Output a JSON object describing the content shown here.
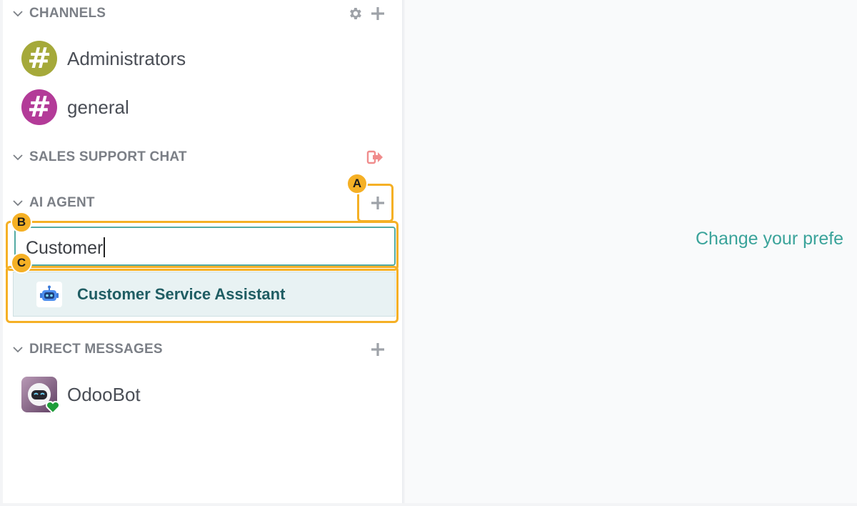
{
  "sidebar": {
    "channels": {
      "title": "CHANNELS",
      "items": [
        {
          "label": "Administrators",
          "color": "#a5a93a"
        },
        {
          "label": "general",
          "color": "#b33b98"
        }
      ]
    },
    "sales_support": {
      "title": "SALES SUPPORT CHAT"
    },
    "ai_agent": {
      "title": "AI AGENT",
      "search_value": "Customer",
      "suggestion": "Customer Service Assistant"
    },
    "direct_messages": {
      "title": "DIRECT MESSAGES",
      "items": [
        {
          "label": "OdooBot"
        }
      ]
    }
  },
  "main": {
    "message": "Change your prefe"
  },
  "annotations": {
    "a": "A",
    "b": "B",
    "c": "C"
  },
  "colors": {
    "accent": "#53aaa3",
    "highlight": "#f5b025",
    "leave_icon": "#f08c8c"
  }
}
